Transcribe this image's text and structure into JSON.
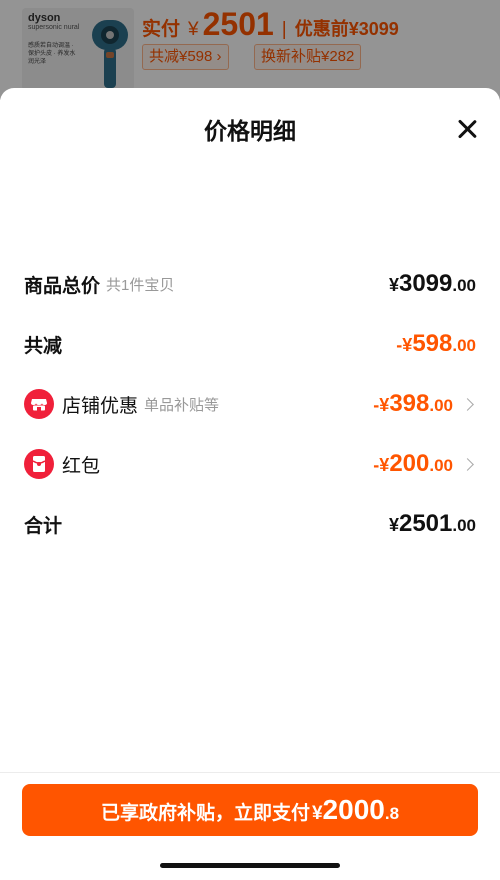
{
  "product": {
    "brand": "dyson",
    "model": "supersonic nural",
    "features": "感质若自动调温 · 保护头皮 · 养发水润光泽",
    "paid_label": "实付",
    "paid_yen": "¥",
    "paid_amount": "2501",
    "separator": "|",
    "original_price": "优惠前¥3099",
    "discount_tag": "共减¥598 ›",
    "tradein_tag": "换新补贴¥282"
  },
  "sheet": {
    "title": "价格明细",
    "close_icon": "close-icon"
  },
  "rows": {
    "total": {
      "label": "商品总价",
      "sub": "共1件宝贝",
      "yen": "¥",
      "int": "3099",
      "dec": ".00"
    },
    "reduce": {
      "label": "共减",
      "yen": "-¥",
      "int": "598",
      "dec": ".00"
    },
    "shop": {
      "label": "店铺优惠",
      "sub": "单品补贴等",
      "yen": "-¥",
      "int": "398",
      "dec": ".00",
      "icon": "shop-icon"
    },
    "redpack": {
      "label": "红包",
      "yen": "-¥",
      "int": "200",
      "dec": ".00",
      "icon": "red-packet-icon"
    },
    "sum": {
      "label": "合计",
      "yen": "¥",
      "int": "2501",
      "dec": ".00"
    }
  },
  "pay_button": {
    "text": "已享政府补贴，立即支付",
    "yen": "¥",
    "int": "2000",
    "dec": ".8"
  },
  "colors": {
    "accent": "#ff5500",
    "badge": "#f0203a"
  }
}
